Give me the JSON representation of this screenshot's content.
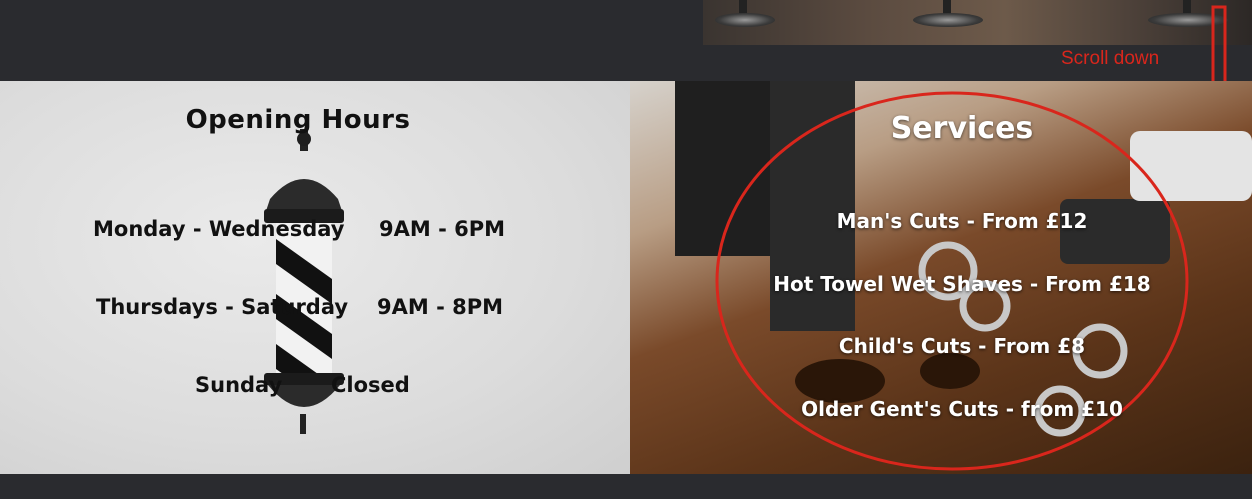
{
  "annotation": {
    "scroll_text": "Scroll down",
    "color": "#d9261c"
  },
  "hours": {
    "title": "Opening Hours",
    "rows": [
      {
        "days": "Monday - Wednesday",
        "time": "9AM - 6PM"
      },
      {
        "days": "Thursdays - Saturday",
        "time": "9AM - 8PM"
      },
      {
        "days": "Sunday",
        "time": "Closed"
      }
    ]
  },
  "services": {
    "title": "Services",
    "items": [
      "Man's Cuts - From £12",
      "Hot Towel Wet Shaves - From £18",
      "Child's Cuts - From £8",
      "Older Gent's Cuts - from £10"
    ]
  },
  "colors": {
    "page_bg": "#2a2b2f",
    "text_dark": "#111111",
    "text_light": "#ffffff"
  }
}
